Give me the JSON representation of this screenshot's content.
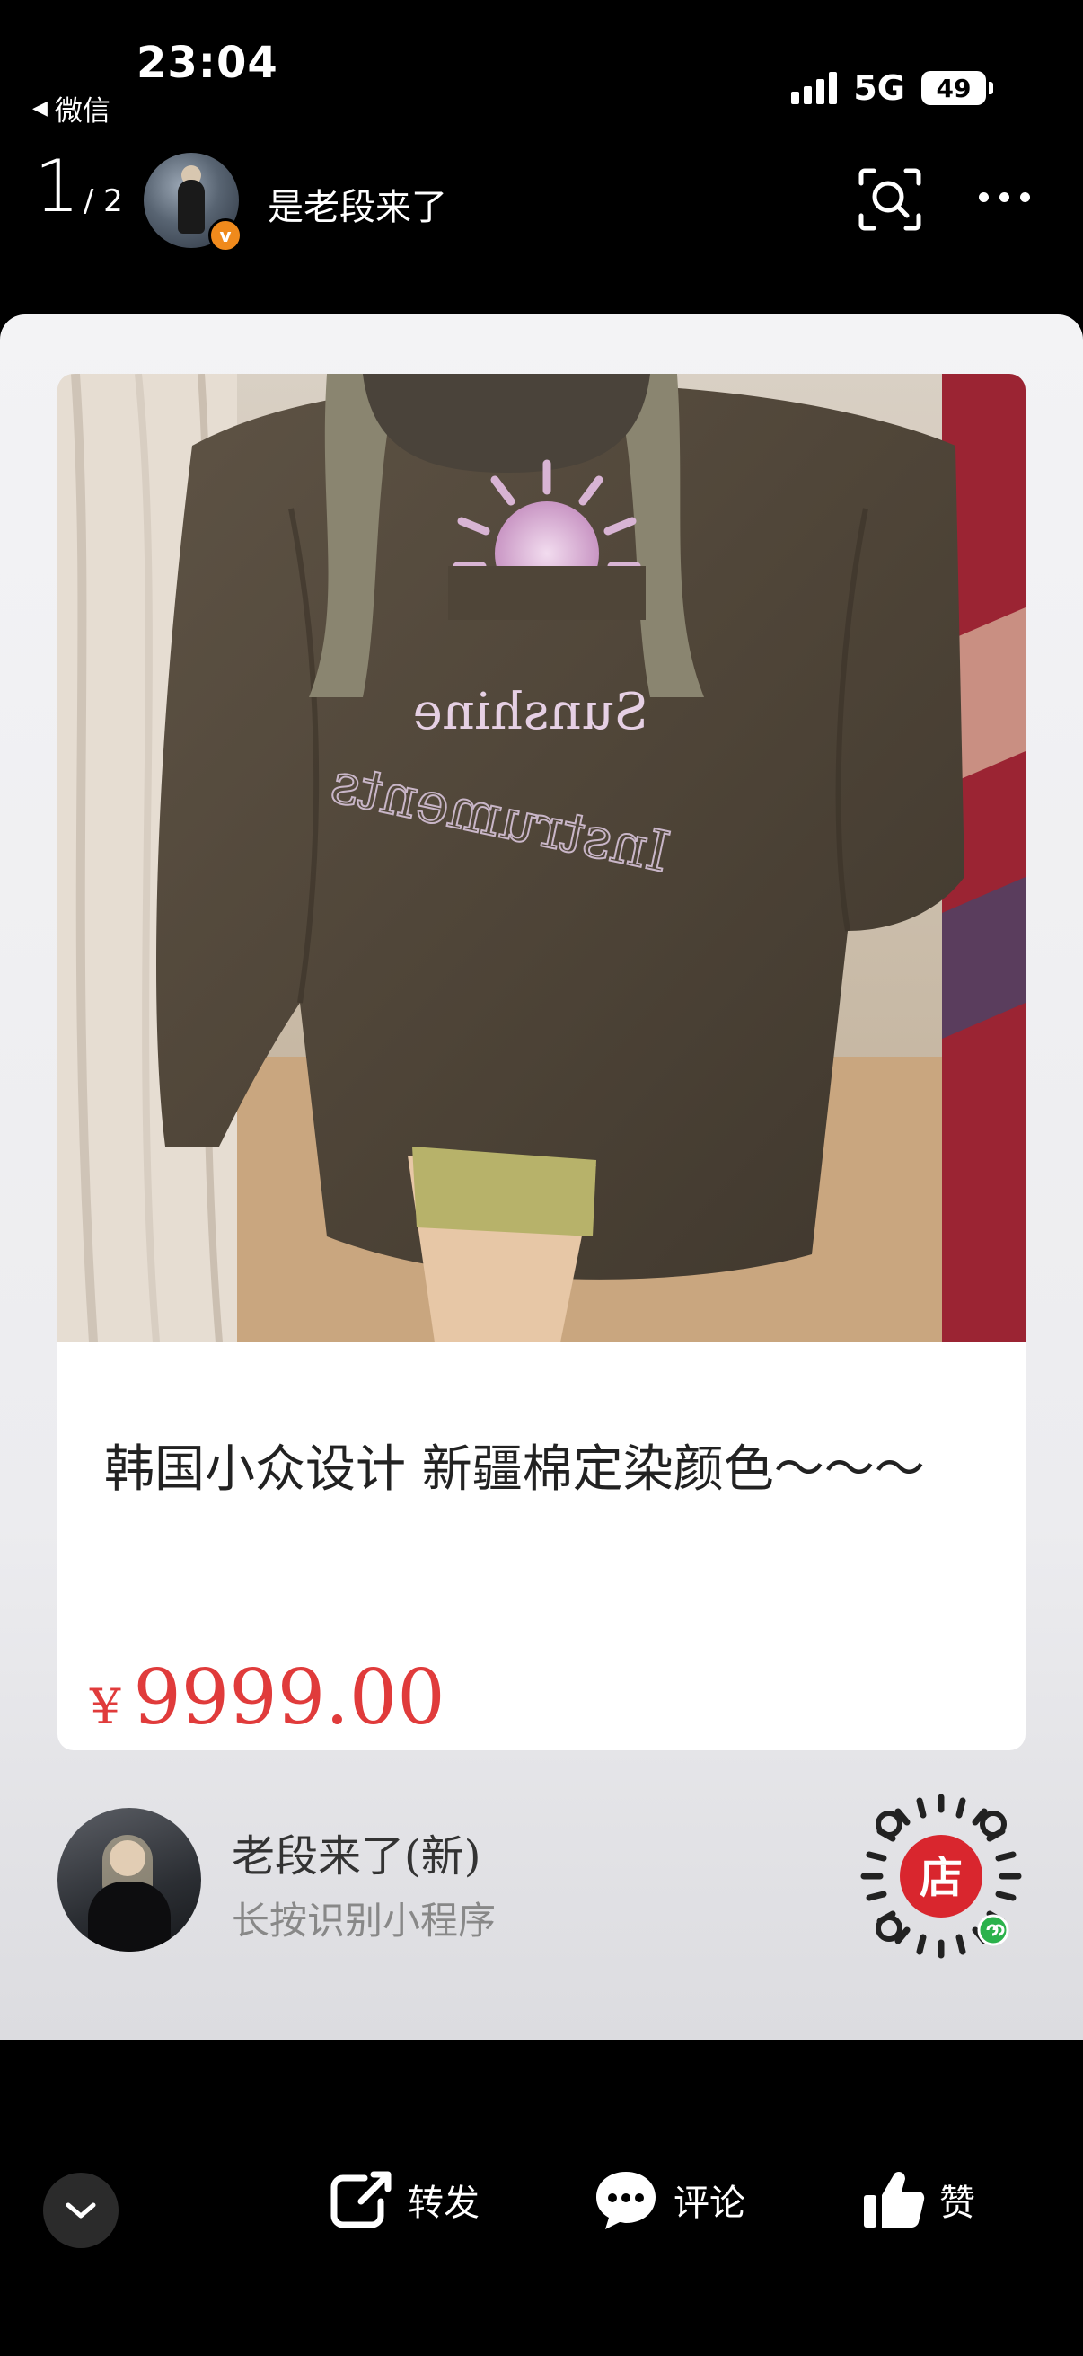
{
  "status_bar": {
    "time": "23:04",
    "back_app": "微信",
    "network": "5G",
    "battery": "49"
  },
  "header": {
    "page_current": "1",
    "page_total": "/ 2",
    "account_name": "是老段来了",
    "verified_badge": "v"
  },
  "product": {
    "title": "韩国小众设计 新疆棉定染颜色～～～",
    "currency": "¥",
    "price": "9999.00",
    "photo_print_text": [
      "Sunshine",
      "Instruments"
    ],
    "accent_color": "#e03b3b"
  },
  "mini_program": {
    "shop_name": "老段来了(新)",
    "hint": "长按识别小程序",
    "qr_center_char": "店"
  },
  "actions": {
    "forward": "转发",
    "comment": "评论",
    "like": "赞"
  },
  "icons": [
    "back-triangle-icon",
    "signal-icon",
    "battery-icon",
    "scan-icon",
    "more-icon",
    "chevron-down-icon",
    "share-icon",
    "comment-icon",
    "thumbs-up-icon",
    "mini-program-icon"
  ]
}
